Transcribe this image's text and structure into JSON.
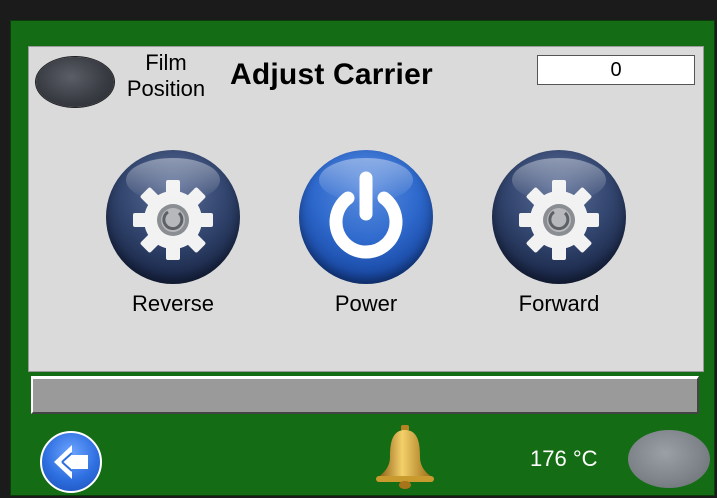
{
  "header": {
    "film_position_label": "Film Position",
    "title": "Adjust Carrier",
    "counter_value": "0"
  },
  "buttons": [
    {
      "label": "Reverse",
      "icon": "gear-icon"
    },
    {
      "label": "Power",
      "icon": "power-icon"
    },
    {
      "label": "Forward",
      "icon": "gear-icon"
    }
  ],
  "footer": {
    "back_icon": "back-arrow-icon",
    "alarm_icon": "bell-icon",
    "temperature": "176 °C"
  },
  "colors": {
    "frame": "#146c14",
    "panel": "#dadada",
    "power_blue": "#2e69cc",
    "gear_navy": "#33466f"
  }
}
